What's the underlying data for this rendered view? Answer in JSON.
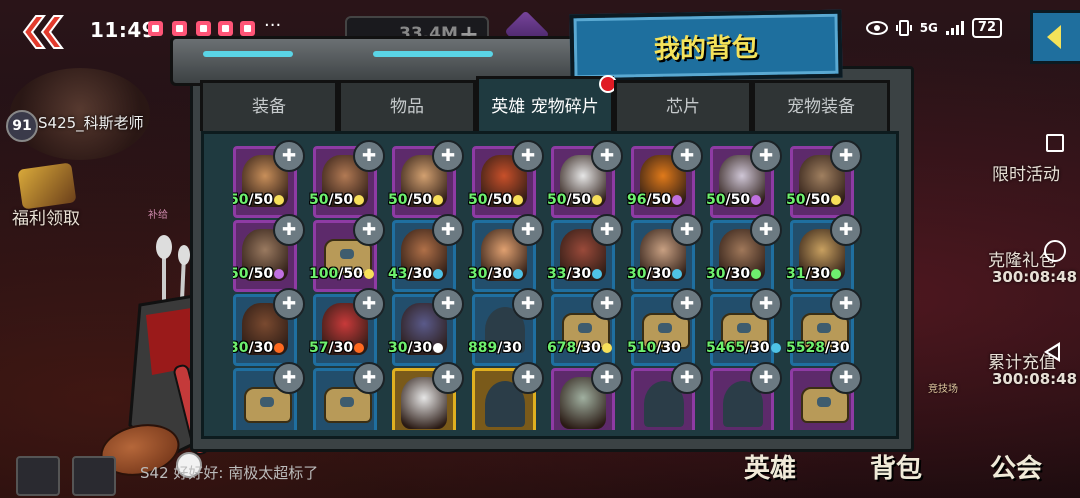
{
  "status_bar": {
    "time": "11:49",
    "more": "···",
    "network": "5G",
    "battery": "72"
  },
  "player": {
    "level": "91",
    "name": "S425_科斯老师"
  },
  "resources": {
    "gold": "33.4M"
  },
  "left_menu": {
    "welfare": "福利领取",
    "tag": "补给"
  },
  "title": "我的背包",
  "tabs": [
    {
      "label": "装备",
      "active": false
    },
    {
      "label": "物品",
      "active": false
    },
    {
      "label": "英雄 宠物碎片",
      "active": true,
      "badge": true
    },
    {
      "label": "芯片",
      "active": false
    },
    {
      "label": "宠物装备",
      "active": false
    }
  ],
  "items": [
    {
      "count": "50",
      "max": "50",
      "frame": "purple",
      "kind": "hero",
      "color": "#c88f5a",
      "elem": "#f7e05a"
    },
    {
      "count": "50",
      "max": "50",
      "frame": "purple",
      "kind": "hero",
      "color": "#b27a54",
      "elem": "#f7e05a"
    },
    {
      "count": "50",
      "max": "50",
      "frame": "purple",
      "kind": "hero",
      "color": "#d2a070",
      "elem": "#f7e05a"
    },
    {
      "count": "50",
      "max": "50",
      "frame": "purple",
      "kind": "hero",
      "color": "#c8502a",
      "elem": "#f7e05a"
    },
    {
      "count": "50",
      "max": "50",
      "frame": "purple",
      "kind": "hero",
      "color": "#e6e6e6",
      "elem": "#f7e05a"
    },
    {
      "count": "96",
      "max": "50",
      "frame": "purple",
      "kind": "hero",
      "color": "#e07a1a",
      "elem": "#c070e0"
    },
    {
      "count": "50",
      "max": "50",
      "frame": "purple",
      "kind": "hero",
      "color": "#cfc6d6",
      "elem": "#c070e0"
    },
    {
      "count": "50",
      "max": "50",
      "frame": "purple",
      "kind": "hero",
      "color": "#a08060",
      "elem": "#f7e05a"
    },
    {
      "count": "50",
      "max": "50",
      "frame": "purple",
      "kind": "hero",
      "color": "#9a7a60",
      "elem": "#c070e0"
    },
    {
      "count": "100",
      "max": "50",
      "frame": "purple",
      "kind": "mech",
      "color": "#b89a58",
      "elem": "#f7e05a"
    },
    {
      "count": "43",
      "max": "30",
      "frame": "blue",
      "kind": "hero",
      "color": "#b07048",
      "elem": "#4fc3e6"
    },
    {
      "count": "30",
      "max": "30",
      "frame": "blue",
      "kind": "hero",
      "color": "#e0a070",
      "elem": "#4fc3e6"
    },
    {
      "count": "33",
      "max": "30",
      "frame": "blue",
      "kind": "hero",
      "color": "#9a4a3a",
      "elem": "#4fc3e6"
    },
    {
      "count": "30",
      "max": "30",
      "frame": "blue",
      "kind": "hero",
      "color": "#c8a082",
      "elem": "#4fc3e6"
    },
    {
      "count": "30",
      "max": "30",
      "frame": "blue",
      "kind": "hero",
      "color": "#a0785a",
      "elem": "#6ef06e"
    },
    {
      "count": "31",
      "max": "30",
      "frame": "blue",
      "kind": "hero",
      "color": "#c8a060",
      "elem": "#6ef06e"
    },
    {
      "count": "30",
      "max": "30",
      "frame": "blue",
      "kind": "hero",
      "color": "#7a4a30",
      "elem": "#ff6a20"
    },
    {
      "count": "57",
      "max": "30",
      "frame": "blue",
      "kind": "hero",
      "color": "#c83a3a",
      "elem": "#ff6a20"
    },
    {
      "count": "30",
      "max": "30",
      "frame": "blue",
      "kind": "hero",
      "color": "#5a5a8a",
      "elem": "#ffffff"
    },
    {
      "count": "889",
      "max": "30",
      "frame": "blue",
      "kind": "silhouette",
      "color": "#2b3d48",
      "elem": ""
    },
    {
      "count": "678",
      "max": "30",
      "frame": "blue",
      "kind": "mech",
      "color": "#b89a58",
      "elem": "#f7e05a"
    },
    {
      "count": "510",
      "max": "30",
      "frame": "blue",
      "kind": "mech",
      "color": "#b89a58",
      "elem": ""
    },
    {
      "count": "5465",
      "max": "30",
      "frame": "blue",
      "kind": "mech",
      "color": "#b89a58",
      "elem": "#4fc3e6"
    },
    {
      "count": "5528",
      "max": "30",
      "frame": "blue",
      "kind": "mech",
      "color": "#b89a58",
      "elem": ""
    },
    {
      "count": "",
      "max": "",
      "frame": "blue",
      "kind": "mech",
      "color": "#b89a58",
      "elem": ""
    },
    {
      "count": "",
      "max": "",
      "frame": "blue",
      "kind": "mech",
      "color": "#b89a58",
      "elem": ""
    },
    {
      "count": "",
      "max": "",
      "frame": "gold",
      "kind": "hero",
      "color": "#e6e6e6",
      "elem": ""
    },
    {
      "count": "",
      "max": "",
      "frame": "gold",
      "kind": "silhouette",
      "color": "#2b3d48",
      "elem": ""
    },
    {
      "count": "",
      "max": "",
      "frame": "purple",
      "kind": "hero",
      "color": "#a0b0a0",
      "elem": ""
    },
    {
      "count": "",
      "max": "",
      "frame": "purple",
      "kind": "silhouette",
      "color": "#2b3d48",
      "elem": ""
    },
    {
      "count": "",
      "max": "",
      "frame": "purple",
      "kind": "silhouette",
      "color": "#2b3d48",
      "elem": ""
    },
    {
      "count": "",
      "max": "",
      "frame": "purple",
      "kind": "mech",
      "color": "#b89a58",
      "elem": ""
    }
  ],
  "right_menu": {
    "limited_event": "限时活动",
    "clone_gift": "克隆礼包",
    "clone_timer": "300:08:48",
    "cumulative": "累计充值",
    "cumulative_timer": "300:08:48",
    "arena": "竞技场"
  },
  "bottom_nav": {
    "hero": "英雄",
    "bag": "背包",
    "guild": "公会"
  },
  "chat": {
    "message": "S42 好好好: 南极太超标了"
  },
  "colors": {
    "title_plate": "#1e6f9e",
    "title_text": "#f4e25a",
    "count_green": "#6ef06e",
    "tab_badge": "#e01b24"
  }
}
